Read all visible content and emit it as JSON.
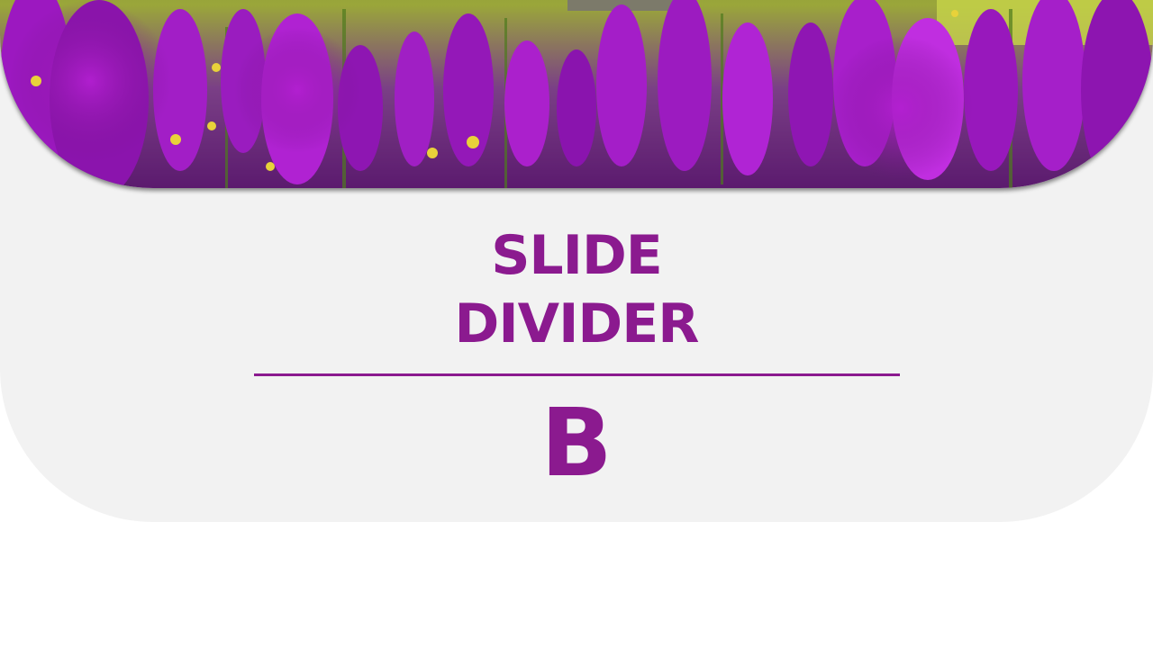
{
  "slide": {
    "title_line1": "SLIDE",
    "title_line2": "DIVIDER",
    "section_letter": "B"
  },
  "image": {
    "description_icon": "lavender-field-photo"
  },
  "colors": {
    "accent": "#8b1a8f",
    "panel": "#f2f2f2",
    "background": "#ffffff"
  }
}
